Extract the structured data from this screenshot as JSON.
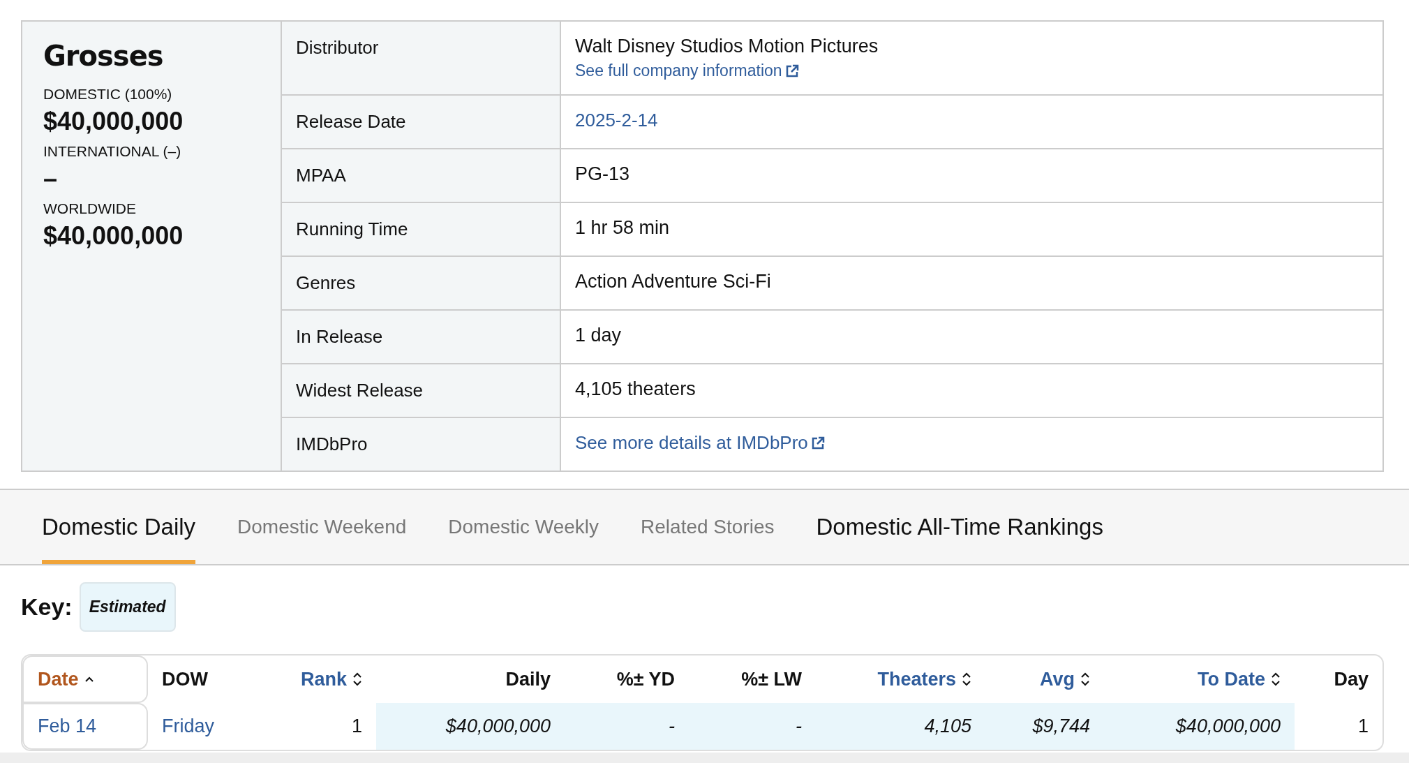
{
  "grosses": {
    "title": "Grosses",
    "figures": [
      {
        "label": "DOMESTIC (100%)",
        "value": "$40,000,000"
      },
      {
        "label": "INTERNATIONAL (–)",
        "value": "–"
      },
      {
        "label": "WORLDWIDE",
        "value": "$40,000,000"
      }
    ]
  },
  "summary": [
    {
      "label": "Distributor",
      "value": "Walt Disney Studios Motion Pictures",
      "kind": "text",
      "note_link": "See full company information"
    },
    {
      "label": "Release Date",
      "value": "2025-2-14",
      "kind": "link"
    },
    {
      "label": "MPAA",
      "value": "PG-13",
      "kind": "text"
    },
    {
      "label": "Running Time",
      "value": "1 hr 58 min",
      "kind": "text"
    },
    {
      "label": "Genres",
      "value": "Action Adventure Sci-Fi",
      "kind": "text"
    },
    {
      "label": "In Release",
      "value": "1 day",
      "kind": "text"
    },
    {
      "label": "Widest Release",
      "value": "4,105 theaters",
      "kind": "text"
    },
    {
      "label": "IMDbPro",
      "value": "See more details at IMDbPro",
      "kind": "external-link"
    }
  ],
  "tabs": [
    {
      "label": "Domestic Daily",
      "kind": "tab",
      "selected": true
    },
    {
      "label": "Domestic Weekend",
      "kind": "tab",
      "selected": false
    },
    {
      "label": "Domestic Weekly",
      "kind": "tab",
      "selected": false
    },
    {
      "label": "Related Stories",
      "kind": "tab",
      "selected": false
    },
    {
      "label": "Domestic All-Time Rankings",
      "kind": "link",
      "selected": false
    }
  ],
  "key": {
    "label": "Key:",
    "badge": "Estimated"
  },
  "table": {
    "columns": [
      {
        "label": "Date",
        "sortable": true,
        "sorted": true
      },
      {
        "label": "DOW",
        "sortable": false
      },
      {
        "label": "Rank",
        "sortable": true,
        "sorted": false
      },
      {
        "label": "Daily",
        "sortable": false
      },
      {
        "label": "%± YD",
        "sortable": false
      },
      {
        "label": "%± LW",
        "sortable": false
      },
      {
        "label": "Theaters",
        "sortable": true,
        "sorted": false
      },
      {
        "label": "Avg",
        "sortable": true,
        "sorted": false
      },
      {
        "label": "To Date",
        "sortable": true,
        "sorted": false
      },
      {
        "label": "Day",
        "sortable": false
      }
    ],
    "rows": [
      {
        "cells": [
          {
            "text": "Feb 14",
            "kind": "link",
            "estimated": false
          },
          {
            "text": "Friday",
            "kind": "link",
            "estimated": false
          },
          {
            "text": "1",
            "kind": "text",
            "estimated": false
          },
          {
            "text": "$40,000,000",
            "kind": "text",
            "estimated": true
          },
          {
            "text": "-",
            "kind": "text",
            "estimated": true
          },
          {
            "text": "-",
            "kind": "text",
            "estimated": true
          },
          {
            "text": "4,105",
            "kind": "text",
            "estimated": true
          },
          {
            "text": "$9,744",
            "kind": "text",
            "estimated": true
          },
          {
            "text": "$40,000,000",
            "kind": "text",
            "estimated": true
          },
          {
            "text": "1",
            "kind": "text",
            "estimated": false
          }
        ]
      }
    ]
  }
}
